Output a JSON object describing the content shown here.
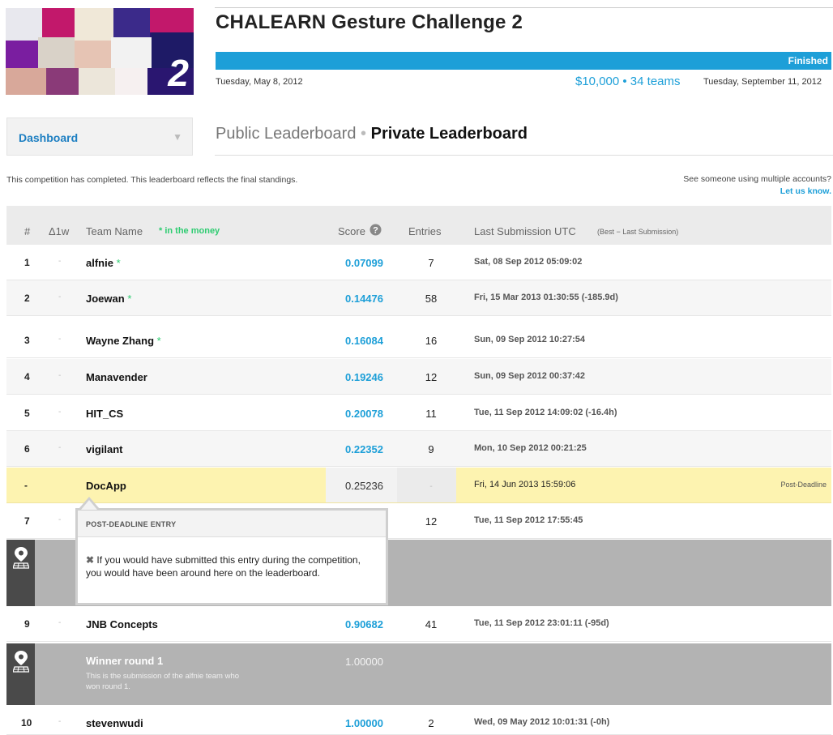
{
  "competition": {
    "title": "CHALEARN Gesture Challenge 2",
    "status": "Finished",
    "start_date": "Tuesday, May 8, 2012",
    "prize_line": "$10,000 • 34 teams",
    "end_date": "Tuesday, September 11, 2012",
    "logo_number": "2"
  },
  "dashboard": {
    "label": "Dashboard",
    "arrow": "▼"
  },
  "tabs": {
    "public": "Public Leaderboard",
    "separator": "•",
    "private": "Private Leaderboard"
  },
  "notice": "This competition has completed. This leaderboard reflects the final standings.",
  "multi_accounts": {
    "question": "See someone using multiple accounts?",
    "link": "Let us know."
  },
  "table_header": {
    "rank": "#",
    "delta": "Δ1w",
    "team": "Team Name",
    "money": "* in the money",
    "score": "Score",
    "entries": "Entries",
    "last_sub": "Last Submission UTC",
    "last_sub_note": "(Best − Last Submission)"
  },
  "rows": [
    {
      "rank": "1",
      "delta": "-",
      "team": "alfnie",
      "star": "*",
      "score": "0.07099",
      "entries": "7",
      "last": "Sat, 08 Sep 2012 05:09:02"
    },
    {
      "rank": "2",
      "delta": "-",
      "team": "Joewan",
      "star": "*",
      "score": "0.14476",
      "entries": "58",
      "last": "Fri, 15 Mar 2013 01:30:55 (-185.9d)"
    },
    {
      "rank": "3",
      "delta": "-",
      "team": "Wayne Zhang",
      "star": "*",
      "score": "0.16084",
      "entries": "16",
      "last": "Sun, 09 Sep 2012 10:27:54"
    },
    {
      "rank": "4",
      "delta": "-",
      "team": "Manavender",
      "star": "",
      "score": "0.19246",
      "entries": "12",
      "last": "Sun, 09 Sep 2012 00:37:42"
    },
    {
      "rank": "5",
      "delta": "-",
      "team": "HIT_CS",
      "star": "",
      "score": "0.20078",
      "entries": "11",
      "last": "Tue, 11 Sep 2012 14:09:02 (-16.4h)"
    },
    {
      "rank": "6",
      "delta": "-",
      "team": "vigilant",
      "star": "",
      "score": "0.22352",
      "entries": "9",
      "last": "Mon, 10 Sep 2012 00:21:25"
    },
    {
      "rank": "7",
      "delta": "-",
      "team": "",
      "star": "",
      "score": "",
      "entries": "12",
      "last": "Tue, 11 Sep 2012 17:55:45"
    },
    {
      "rank": "9",
      "delta": "-",
      "team": "JNB Concepts",
      "star": "",
      "score": "0.90682",
      "entries": "41",
      "last": "Tue, 11 Sep 2012 23:01:11 (-95d)"
    },
    {
      "rank": "10",
      "delta": "-",
      "team": "stevenwudi",
      "star": "",
      "score": "1.00000",
      "entries": "2",
      "last": "Wed, 09 May 2012 10:01:31 (-0h)"
    }
  ],
  "post_deadline": {
    "rank": "-",
    "team": "DocApp",
    "score": "0.25236",
    "entries": "-",
    "last": "Fri, 14 Jun 2013 15:59:06",
    "tag": "Post-Deadline"
  },
  "benchmark": {
    "name": "Winner round 1",
    "desc": "This is the submission of the alfnie team who won round 1.",
    "score": "1.00000"
  },
  "popover": {
    "title": "POST-DEADLINE ENTRY",
    "x": "✖",
    "text": "If you would have submitted this entry during the competition, you would have been around here on the leaderboard."
  },
  "colors": {
    "accent": "#1d9fd8",
    "money": "#2ecc71",
    "post_deadline": "#fdf3b0",
    "benchmark": "#b3b3b3"
  }
}
